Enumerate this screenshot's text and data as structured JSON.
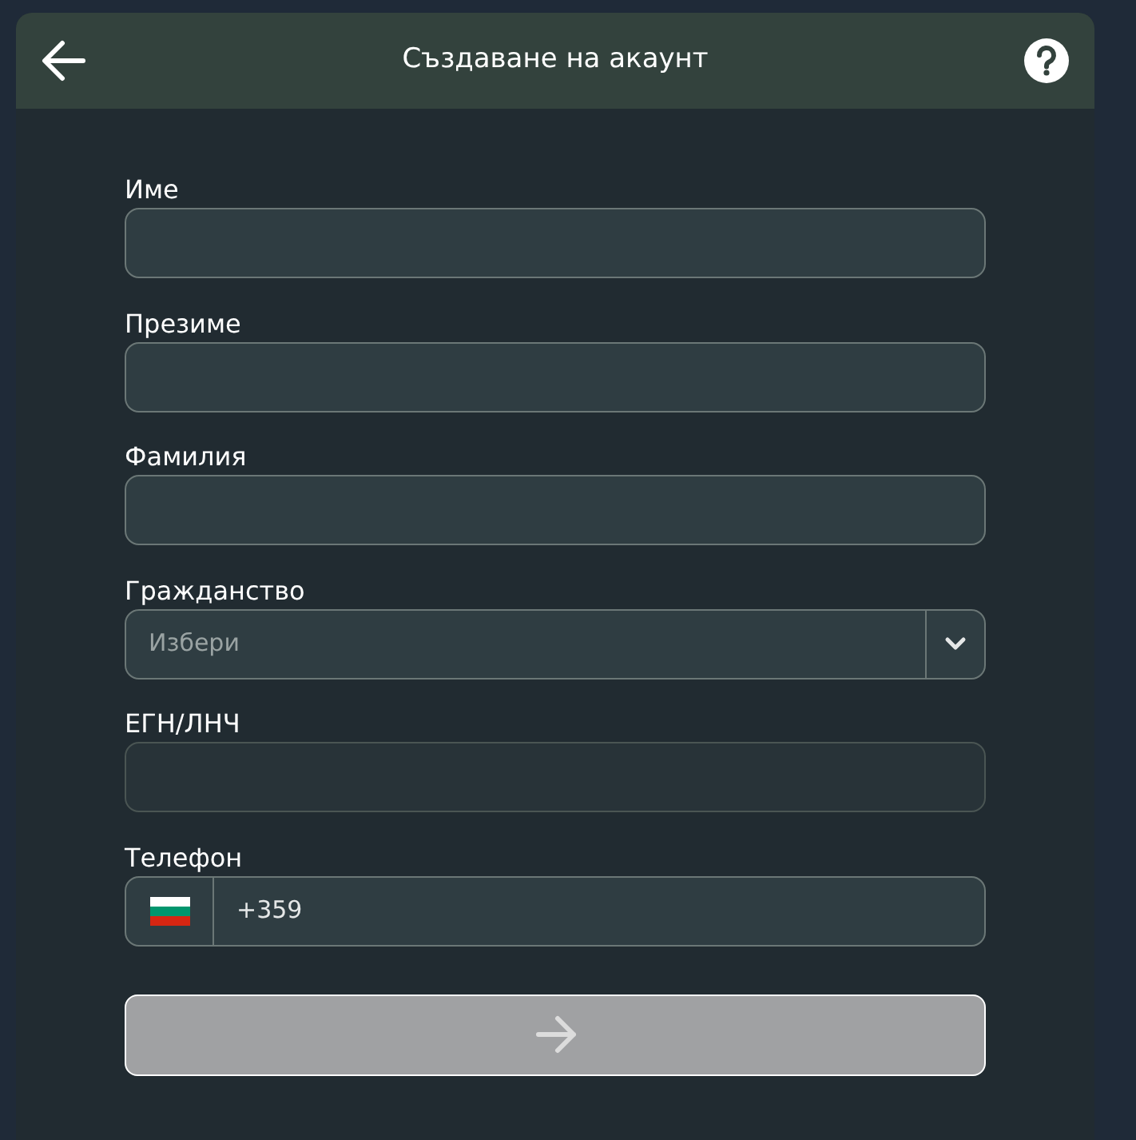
{
  "header": {
    "title": "Създаване на акаунт"
  },
  "fields": [
    {
      "kind": "text",
      "label": "Име",
      "disabled": false
    },
    {
      "kind": "text",
      "label": "Презиме",
      "disabled": false
    },
    {
      "kind": "text",
      "label": "Фамилия",
      "disabled": false
    },
    {
      "kind": "select",
      "label": "Гражданство",
      "placeholder": "Избери",
      "disabled": false
    },
    {
      "kind": "text",
      "label": "ЕГН/ЛНЧ",
      "disabled": true
    },
    {
      "kind": "phone",
      "label": "Телефон",
      "value": "+359",
      "disabled": false
    }
  ],
  "submit": {
    "disabled": true
  }
}
